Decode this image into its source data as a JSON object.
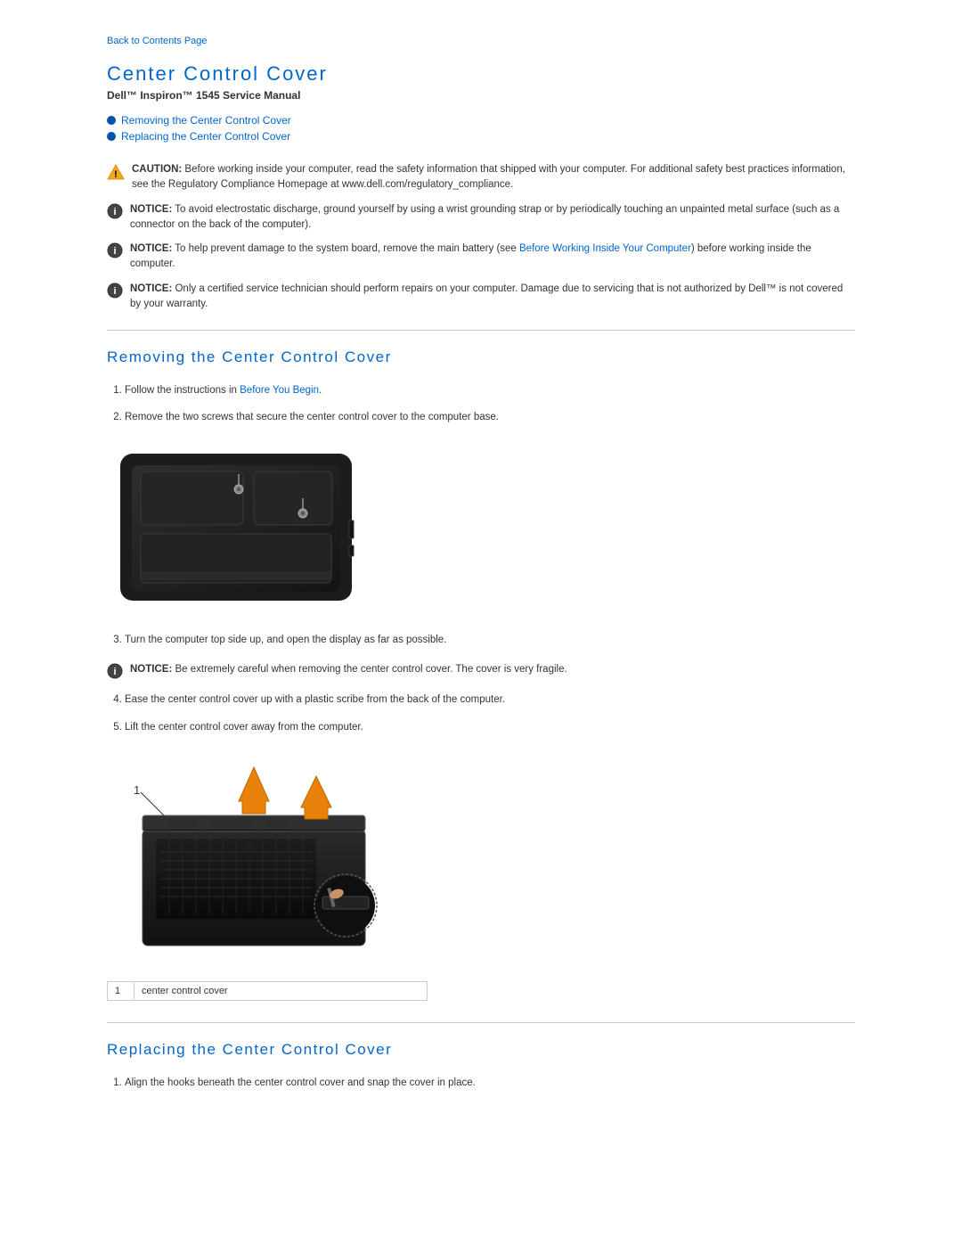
{
  "header": {
    "back_link": "Back to Contents Page",
    "page_title": "Center Control Cover",
    "subtitle": "Dell™ Inspiron™ 1545 Service Manual"
  },
  "toc": {
    "items": [
      {
        "label": "Removing the Center Control Cover",
        "anchor": "#removing"
      },
      {
        "label": "Replacing the Center Control Cover",
        "anchor": "#replacing"
      }
    ]
  },
  "notices": [
    {
      "type": "caution",
      "label": "CAUTION:",
      "text": "Before working inside your computer, read the safety information that shipped with your computer. For additional safety best practices information, see the Regulatory Compliance Homepage at www.dell.com/regulatory_compliance."
    },
    {
      "type": "notice",
      "label": "NOTICE:",
      "text": "To avoid electrostatic discharge, ground yourself by using a wrist grounding strap or by periodically touching an unpainted metal surface (such as a connector on the back of the computer)."
    },
    {
      "type": "notice",
      "label": "NOTICE:",
      "text": "To help prevent damage to the system board, remove the main battery (see Before Working Inside Your Computer) before working inside the computer."
    },
    {
      "type": "notice",
      "label": "NOTICE:",
      "text": "Only a certified service technician should perform repairs on your computer. Damage due to servicing that is not authorized by Dell™ is not covered by your warranty."
    }
  ],
  "removing_section": {
    "title": "Removing the Center Control Cover",
    "steps": [
      {
        "text": "Follow the instructions in ",
        "link_text": "Before You Begin",
        "text_after": "."
      },
      {
        "text": "Remove the two screws that secure the center control cover to the computer base."
      },
      {
        "text": "Turn the computer top side up, and open the display as far as possible."
      },
      {
        "notice_label": "NOTICE:",
        "notice_text": "Be extremely careful when removing the center control cover. The cover is very fragile."
      },
      {
        "text": "Ease the center control cover up with a plastic scribe from the back of the computer."
      },
      {
        "text": "Lift the center control cover away from the computer."
      }
    ]
  },
  "figure": {
    "number": "1",
    "caption": "center control cover"
  },
  "replacing_section": {
    "title": "Replacing the Center Control Cover",
    "steps": [
      {
        "text": "Align the hooks beneath the center control cover and snap the cover in place."
      }
    ]
  }
}
